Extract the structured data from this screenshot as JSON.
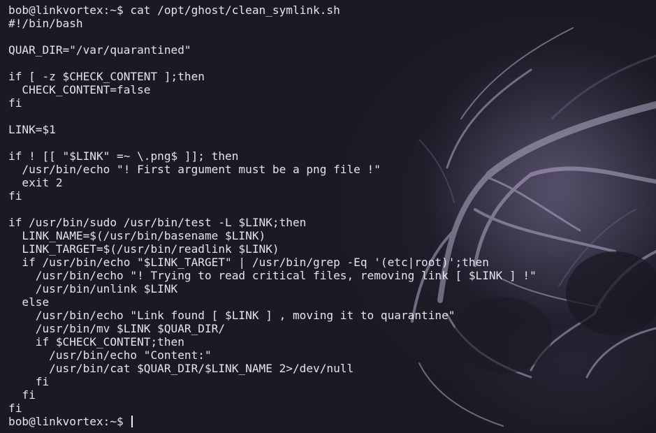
{
  "terminal": {
    "lines": [
      "bob@linkvortex:~$ cat /opt/ghost/clean_symlink.sh",
      "#!/bin/bash",
      "",
      "QUAR_DIR=\"/var/quarantined\"",
      "",
      "if [ -z $CHECK_CONTENT ];then",
      "  CHECK_CONTENT=false",
      "fi",
      "",
      "LINK=$1",
      "",
      "if ! [[ \"$LINK\" =~ \\.png$ ]]; then",
      "  /usr/bin/echo \"! First argument must be a png file !\"",
      "  exit 2",
      "fi",
      "",
      "if /usr/bin/sudo /usr/bin/test -L $LINK;then",
      "  LINK_NAME=$(/usr/bin/basename $LINK)",
      "  LINK_TARGET=$(/usr/bin/readlink $LINK)",
      "  if /usr/bin/echo \"$LINK_TARGET\" | /usr/bin/grep -Eq '(etc|root)';then",
      "    /usr/bin/echo \"! Trying to read critical files, removing link [ $LINK ] !\"",
      "    /usr/bin/unlink $LINK",
      "  else",
      "    /usr/bin/echo \"Link found [ $LINK ] , moving it to quarantine\"",
      "    /usr/bin/mv $LINK $QUAR_DIR/",
      "    if $CHECK_CONTENT;then",
      "      /usr/bin/echo \"Content:\"",
      "      /usr/bin/cat $QUAR_DIR/$LINK_NAME 2>/dev/null",
      "    fi",
      "  fi",
      "fi"
    ],
    "prompt": "bob@linkvortex:~$ ",
    "input_value": ""
  },
  "colors": {
    "background": "#1a1a24",
    "foreground": "#e4e4ea",
    "wallpaper_accent": "#8a7fa6"
  }
}
